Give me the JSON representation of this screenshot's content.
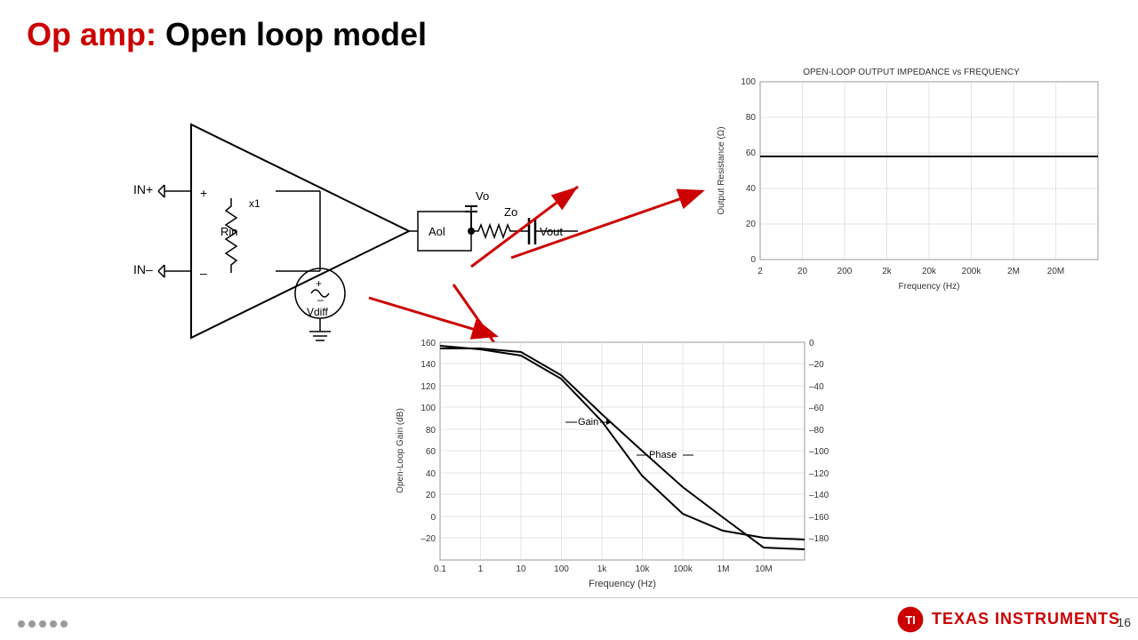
{
  "title": {
    "highlight": "Op amp:",
    "rest": " Open loop model"
  },
  "circuit": {
    "labels": {
      "in_plus": "IN+",
      "in_minus": "IN–",
      "rin": "Rin",
      "x1": "x1",
      "aol": "Aol",
      "vo": "Vo",
      "zo": "Zo",
      "vdiff": "Vdiff",
      "vout": "Vout"
    }
  },
  "chart_impedance": {
    "title": "OPEN-LOOP OUTPUT IMPEDANCE vs FREQUENCY",
    "x_label": "Frequency (Hz)",
    "y_label": "Output Resistance (Ω)",
    "x_ticks": [
      "2",
      "20",
      "200",
      "2k",
      "20k",
      "200k",
      "2M",
      "20M"
    ],
    "y_ticks": [
      "0",
      "20",
      "40",
      "60",
      "80",
      "100"
    ],
    "flat_value": 58
  },
  "chart_gain": {
    "x_label": "Frequency (Hz)",
    "y_label_left": "Open-Loop Gain (dB)",
    "y_label_right": "",
    "x_ticks": [
      "0.1",
      "1",
      "10",
      "100",
      "1k",
      "10k",
      "100k",
      "1M",
      "10M"
    ],
    "y_ticks_left": [
      "-20",
      "0",
      "20",
      "40",
      "60",
      "80",
      "100",
      "120",
      "140",
      "160"
    ],
    "y_ticks_right": [
      "-180",
      "-160",
      "-140",
      "-120",
      "-100",
      "-80",
      "-60",
      "-40",
      "-20",
      "0"
    ],
    "gain_label": "Gain",
    "phase_label": "Phase"
  },
  "footer": {
    "company": "TEXAS INSTRUMENTS",
    "slide_number": "16"
  },
  "nav": {
    "dots": 5
  }
}
